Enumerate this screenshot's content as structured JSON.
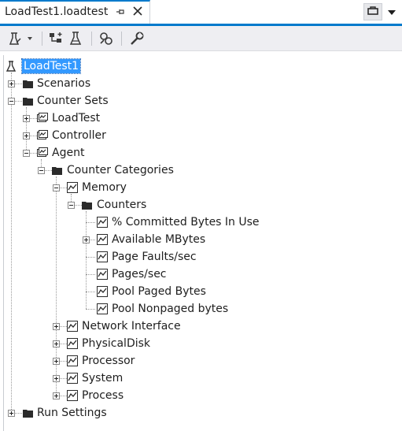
{
  "tab": {
    "title": "LoadTest1.loadtest"
  },
  "icons": {
    "pin": "pin-icon",
    "close": "close-icon",
    "toolbar": [
      "run-test-icon",
      "add-scenario-icon",
      "add-plugin-icon",
      "manage-counters-icon",
      "settings-icon"
    ]
  },
  "colors": {
    "accent": "#007acc",
    "selection": "#3399ff",
    "toolbar_bg": "#eeeef2"
  },
  "tree": {
    "root": "LoadTest1",
    "scenarios": "Scenarios",
    "counter_sets": "Counter Sets",
    "cs_loadtest": "LoadTest",
    "cs_controller": "Controller",
    "cs_agent": "Agent",
    "counter_categories": "Counter Categories",
    "memory": "Memory",
    "counters": "Counters",
    "counter_list": [
      "% Committed Bytes In Use",
      "Available MBytes",
      "Page Faults/sec",
      "Pages/sec",
      "Pool Paged Bytes",
      "Pool Nonpaged bytes"
    ],
    "network_interface": "Network Interface",
    "physical_disk": "PhysicalDisk",
    "processor": "Processor",
    "system": "System",
    "process": "Process",
    "run_settings": "Run Settings"
  }
}
